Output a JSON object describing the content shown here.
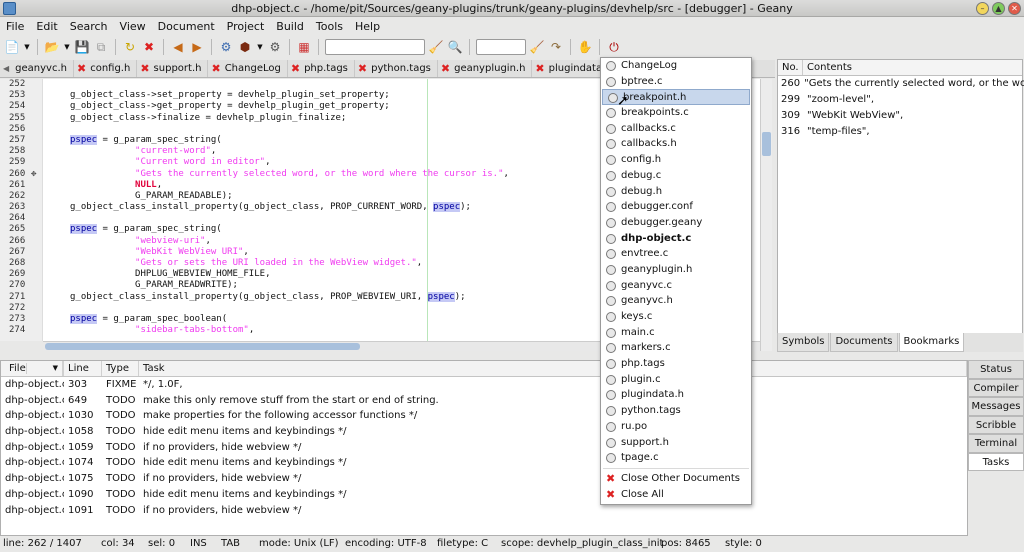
{
  "window": {
    "title": "dhp-object.c - /home/pit/Sources/geany-plugins/trunk/geany-plugins/devhelp/src - [debugger] - Geany"
  },
  "menu": [
    "File",
    "Edit",
    "Search",
    "View",
    "Document",
    "Project",
    "Build",
    "Tools",
    "Help"
  ],
  "tabs": [
    "geanyvc.h",
    "config.h",
    "support.h",
    "ChangeLog",
    "php.tags",
    "python.tags",
    "geanyplugin.h",
    "plugindata.h"
  ],
  "gutter": [
    "252",
    "253",
    "254",
    "255",
    "256",
    "257",
    "258",
    "259",
    "260",
    "261",
    "262",
    "263",
    "264",
    "265",
    "266",
    "267",
    "268",
    "269",
    "270",
    "271",
    "272",
    "273",
    "274"
  ],
  "code": [
    [
      {
        "t": ""
      }
    ],
    [
      {
        "t": "g_object_class->set_property = devhelp_plugin_set_property;"
      }
    ],
    [
      {
        "t": "g_object_class->get_property = devhelp_plugin_get_property;"
      }
    ],
    [
      {
        "t": "g_object_class->finalize = devhelp_plugin_finalize;"
      }
    ],
    [
      {
        "t": ""
      }
    ],
    [
      {
        "t": "pspec",
        "c": "hl"
      },
      {
        "t": " = g_param_spec_string("
      }
    ],
    [
      {
        "t": "            "
      },
      {
        "t": "\"current-word\"",
        "c": "str"
      },
      {
        "t": ","
      }
    ],
    [
      {
        "t": "            "
      },
      {
        "t": "\"Current word in editor\"",
        "c": "str"
      },
      {
        "t": ","
      }
    ],
    [
      {
        "t": "            "
      },
      {
        "t": "\"Gets the currently selected word, or the word where the cursor is.\"",
        "c": "str"
      },
      {
        "t": ","
      }
    ],
    [
      {
        "t": "            "
      },
      {
        "t": "NULL",
        "c": "kw"
      },
      {
        "t": ","
      }
    ],
    [
      {
        "t": "            G_PARAM_READABLE);"
      }
    ],
    [
      {
        "t": "g_object_class_install_property(g_object_class, PROP_CURRENT_WORD, "
      },
      {
        "t": "pspec",
        "c": "hl"
      },
      {
        "t": ");"
      }
    ],
    [
      {
        "t": ""
      }
    ],
    [
      {
        "t": "pspec",
        "c": "hl"
      },
      {
        "t": " = g_param_spec_string("
      }
    ],
    [
      {
        "t": "            "
      },
      {
        "t": "\"webview-uri\"",
        "c": "str"
      },
      {
        "t": ","
      }
    ],
    [
      {
        "t": "            "
      },
      {
        "t": "\"WebKit WebView URI\"",
        "c": "str"
      },
      {
        "t": ","
      }
    ],
    [
      {
        "t": "            "
      },
      {
        "t": "\"Gets or sets the URI loaded in the WebView widget.\"",
        "c": "str"
      },
      {
        "t": ","
      }
    ],
    [
      {
        "t": "            DHPLUG_WEBVIEW_HOME_FILE,"
      }
    ],
    [
      {
        "t": "            G_PARAM_READWRITE);"
      }
    ],
    [
      {
        "t": "g_object_class_install_property(g_object_class, PROP_WEBVIEW_URI, "
      },
      {
        "t": "pspec",
        "c": "hl"
      },
      {
        "t": ");"
      }
    ],
    [
      {
        "t": ""
      }
    ],
    [
      {
        "t": "pspec",
        "c": "hl"
      },
      {
        "t": " = g_param_spec_boolean("
      }
    ],
    [
      {
        "t": "            "
      },
      {
        "t": "\"sidebar-tabs-bottom\"",
        "c": "str"
      },
      {
        "t": ","
      }
    ]
  ],
  "right_panel": {
    "headers": [
      "No.",
      "Contents"
    ],
    "rows": [
      [
        "260",
        "\"Gets the currently selected word, or the wo..."
      ],
      [
        "299",
        "\"zoom-level\","
      ],
      [
        "309",
        "\"WebKit WebView\","
      ],
      [
        "316",
        "\"temp-files\","
      ]
    ],
    "tabs": [
      "Symbols",
      "Documents",
      "Bookmarks"
    ]
  },
  "tasks": {
    "headers": [
      "File",
      "Line",
      "Type",
      "Task"
    ],
    "rows": [
      [
        "dhp-object.c",
        "303",
        "FIXME",
        "*/, 1.0F,"
      ],
      [
        "dhp-object.c",
        "649",
        "TODO",
        "make this only remove stuff from the start or end of string."
      ],
      [
        "dhp-object.c",
        "1030",
        "TODO",
        "make properties for the following accessor functions */"
      ],
      [
        "dhp-object.c",
        "1058",
        "TODO",
        "hide edit menu items and keybindings */"
      ],
      [
        "dhp-object.c",
        "1059",
        "TODO",
        "if no providers, hide webview */"
      ],
      [
        "dhp-object.c",
        "1074",
        "TODO",
        "hide edit menu items and keybindings */"
      ],
      [
        "dhp-object.c",
        "1075",
        "TODO",
        "if no providers, hide webview */"
      ],
      [
        "dhp-object.c",
        "1090",
        "TODO",
        "hide edit menu items and keybindings */"
      ],
      [
        "dhp-object.c",
        "1091",
        "TODO",
        "if no providers, hide webview */"
      ]
    ]
  },
  "msg_tabs": [
    "Status",
    "Compiler",
    "Messages",
    "Scribble",
    "Terminal",
    "Tasks"
  ],
  "popup": {
    "items": [
      "ChangeLog",
      "bptree.c",
      "breakpoint.h",
      "breakpoints.c",
      "callbacks.c",
      "callbacks.h",
      "config.h",
      "debug.c",
      "debug.h",
      "debugger.conf",
      "debugger.geany",
      "dhp-object.c",
      "envtree.c",
      "geanyplugin.h",
      "geanyvc.c",
      "geanyvc.h",
      "keys.c",
      "main.c",
      "markers.c",
      "php.tags",
      "plugin.c",
      "plugindata.h",
      "python.tags",
      "ru.po",
      "support.h",
      "tpage.c"
    ],
    "selected": "breakpoint.h",
    "bold": "dhp-object.c",
    "actions": [
      "Close Other Documents",
      "Close All"
    ]
  },
  "status": [
    "line: 262 / 1407",
    "col: 34",
    "sel: 0",
    "INS",
    "TAB",
    "mode: Unix (LF)",
    "encoding: UTF-8",
    "filetype: C",
    "scope: devhelp_plugin_class_init",
    "pos: 8465",
    "style: 0"
  ],
  "colors": {
    "string": "#f03cf0",
    "keyword": "#e0003a",
    "highlight": "#c5c9f5",
    "selection": "#c8d7ec"
  }
}
